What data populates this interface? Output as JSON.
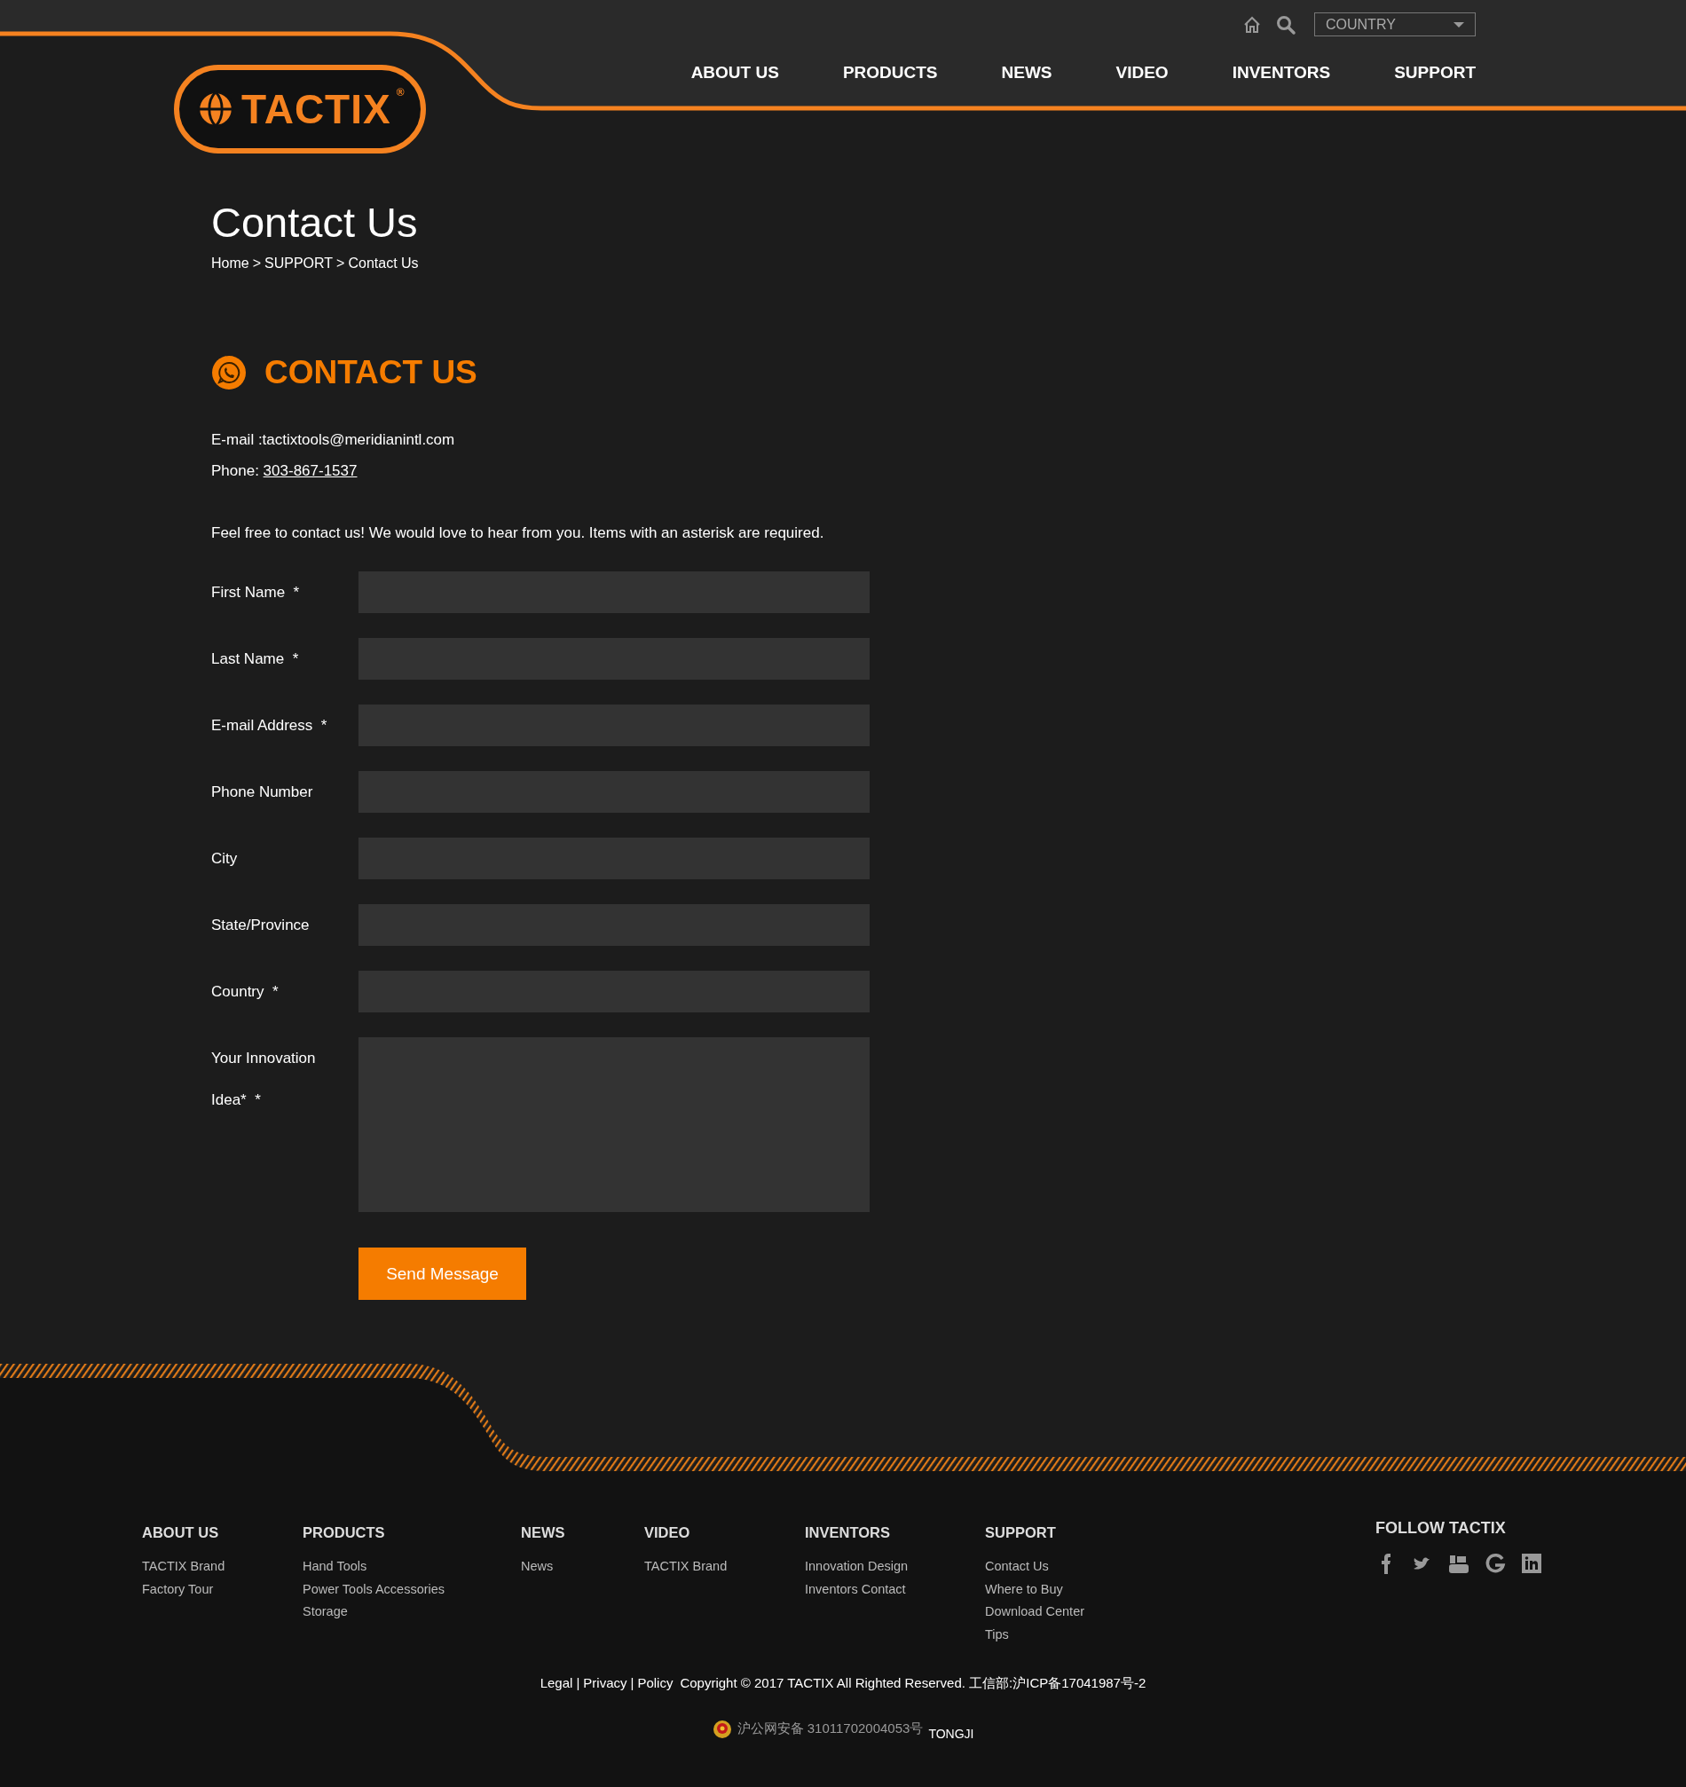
{
  "header": {
    "country_select": {
      "value": "COUNTRY"
    },
    "logo": {
      "text": "TACTIX",
      "mark": "®"
    },
    "nav": [
      "ABOUT US",
      "PRODUCTS",
      "NEWS",
      "VIDEO",
      "INVENTORS",
      "SUPPORT"
    ]
  },
  "page": {
    "title": "Contact Us",
    "breadcrumb": [
      "Home",
      "SUPPORT",
      "Contact Us"
    ],
    "separator": ">"
  },
  "contact": {
    "heading": "CONTACT US",
    "email_line": "E-mail :tactixtools@meridianintl.com",
    "phone_label": "Phone:",
    "phone": "303-867-1537",
    "intro": "Feel free to contact us! We would love to hear from you. Items with an asterisk are required."
  },
  "form": {
    "fields": [
      {
        "label": "First Name",
        "required_mark": "*",
        "kind": "input"
      },
      {
        "label": "Last Name",
        "required_mark": "*",
        "kind": "input"
      },
      {
        "label": "E-mail Address",
        "required_mark": "*",
        "kind": "input"
      },
      {
        "label": "Phone Number",
        "kind": "input"
      },
      {
        "label": "City",
        "kind": "input"
      },
      {
        "label": "State/Province",
        "kind": "input"
      },
      {
        "label": "Country",
        "required_mark": "*",
        "kind": "input"
      },
      {
        "label": "Your Innovation Idea*",
        "required_mark": "*",
        "kind": "textarea"
      }
    ],
    "button": "Send Message"
  },
  "footer": {
    "columns": [
      {
        "heading": "ABOUT US",
        "links": [
          "TACTIX Brand",
          "Factory Tour"
        ]
      },
      {
        "heading": "PRODUCTS",
        "links": [
          "Hand Tools",
          "Power Tools Accessories",
          "Storage"
        ]
      },
      {
        "heading": "NEWS",
        "links": [
          "News"
        ]
      },
      {
        "heading": "VIDEO",
        "links": [
          "TACTIX Brand"
        ]
      },
      {
        "heading": "INVENTORS",
        "links": [
          "Innovation Design",
          "Inventors Contact"
        ]
      },
      {
        "heading": "SUPPORT",
        "links": [
          "Contact Us",
          "Where to Buy",
          "Download Center",
          "Tips"
        ]
      }
    ],
    "follow_heading": "FOLLOW TACTIX",
    "legal_links": [
      "Legal",
      "Privacy",
      "Policy"
    ],
    "separator": "|",
    "copyright": "Copyright © 2017 TACTIX All Righted Reserved. 工信部:沪ICP备17041987号-2",
    "registration": "沪公网安备 31011702004053号",
    "tongji": "TONGJI"
  }
}
